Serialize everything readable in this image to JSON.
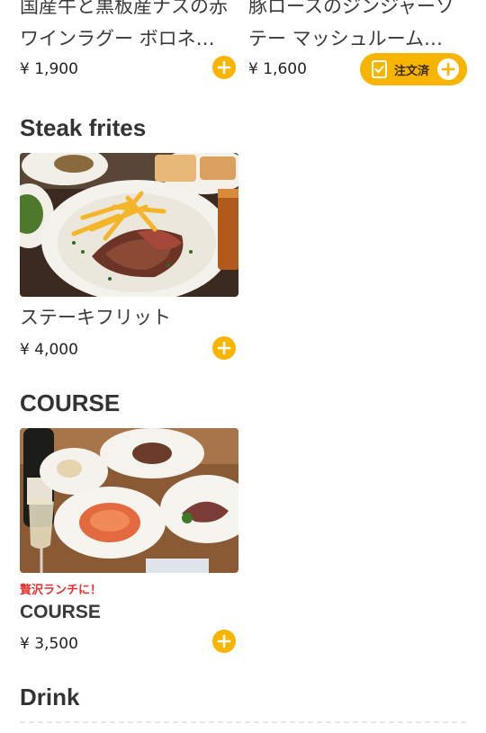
{
  "items_top": [
    {
      "line1": "国産牛と黒板産ナスの赤",
      "line2": "ワインラグー ボロネ…",
      "price": "¥ 1,900"
    },
    {
      "line1": "豚ロースのジンジャーソ",
      "line2": "テー マッシュルーム…",
      "price": "¥ 1,600",
      "ordered_label": "注文済"
    }
  ],
  "sections": {
    "steak": {
      "title": "Steak frites",
      "item": {
        "name": "ステーキフリット",
        "price": "¥ 4,000"
      }
    },
    "course": {
      "title": "COURSE",
      "item": {
        "badge": "贅沢ランチに！",
        "name": "COURSE",
        "price": "¥ 3,500"
      }
    },
    "drink": {
      "title": "Drink"
    }
  },
  "icons": {
    "add": "plus-circle-icon",
    "ordered": "checked-document-icon"
  },
  "colors": {
    "accent": "#f7b400",
    "badge": "#e8312f",
    "text": "#333333"
  }
}
